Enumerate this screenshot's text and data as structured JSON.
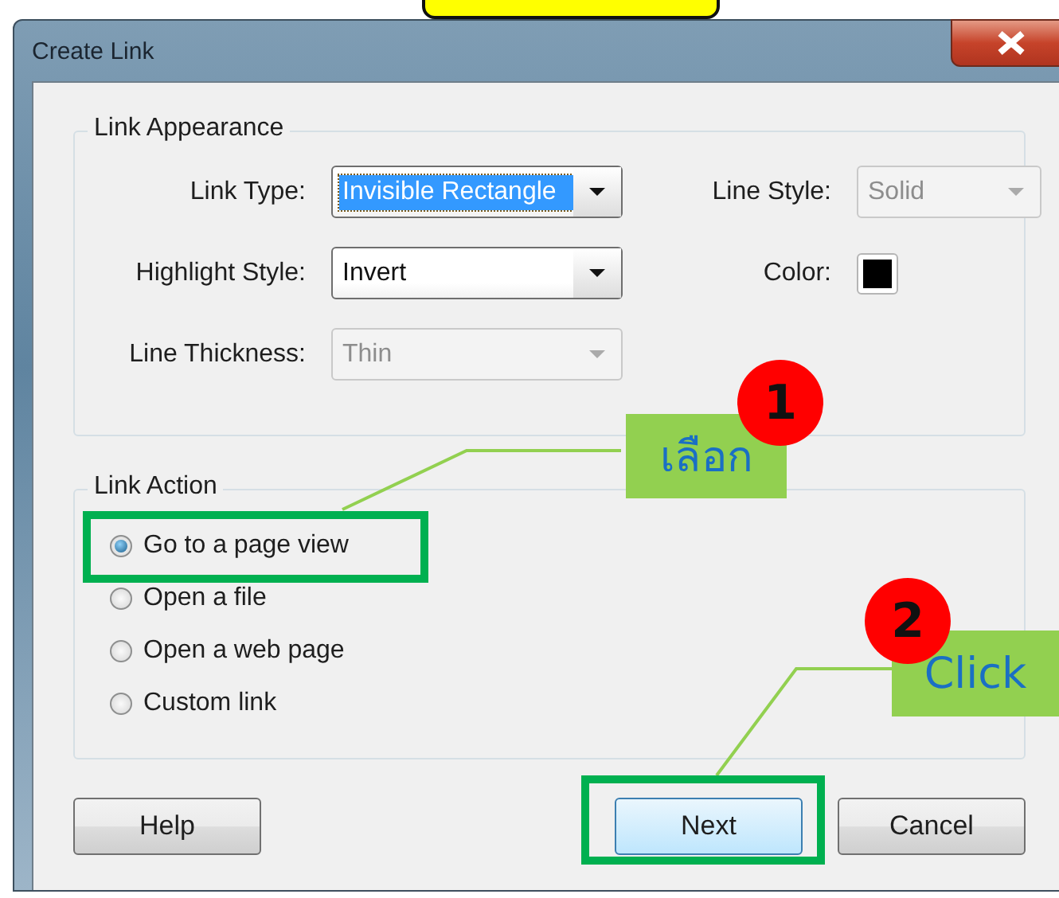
{
  "window": {
    "title": "Create Link"
  },
  "link_appearance": {
    "title": "Link Appearance",
    "fields": [
      {
        "label": "Link Type:",
        "kind": "dropdown",
        "value": "Invisible Rectangle",
        "disabled": false,
        "selected": true
      },
      {
        "label": "Line Style:",
        "kind": "dropdown",
        "value": "Solid",
        "disabled": true,
        "selected": false
      },
      {
        "label": "Highlight Style:",
        "kind": "dropdown",
        "value": "Invert",
        "disabled": false,
        "selected": false
      },
      {
        "label": "Color:",
        "kind": "color",
        "color": "#000000"
      },
      {
        "label": "Line Thickness:",
        "kind": "dropdown",
        "value": "Thin",
        "disabled": true,
        "selected": false
      }
    ]
  },
  "link_action": {
    "title": "Link Action",
    "options": [
      {
        "label": "Go to a page view",
        "selected": true
      },
      {
        "label": "Open a file",
        "selected": false
      },
      {
        "label": "Open a web page",
        "selected": false
      },
      {
        "label": "Custom link",
        "selected": false
      }
    ]
  },
  "buttons": [
    {
      "label": "Help",
      "default": false
    },
    {
      "label": "Next",
      "default": true
    },
    {
      "label": "Cancel",
      "default": false
    }
  ],
  "annotations": [
    {
      "number": "1",
      "label": "เลือก"
    },
    {
      "number": "2",
      "label": "Click"
    }
  ]
}
